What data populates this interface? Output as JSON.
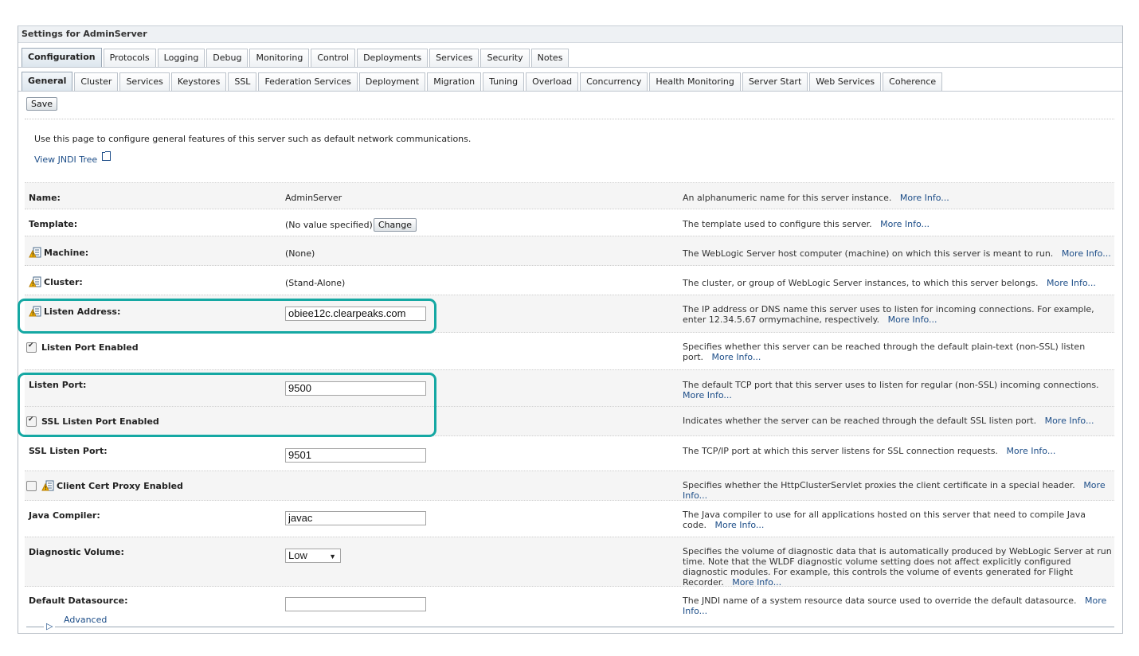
{
  "panel": {
    "title": "Settings for AdminServer"
  },
  "main_tabs": [
    {
      "label": "Configuration",
      "active": true
    },
    {
      "label": "Protocols"
    },
    {
      "label": "Logging"
    },
    {
      "label": "Debug"
    },
    {
      "label": "Monitoring"
    },
    {
      "label": "Control"
    },
    {
      "label": "Deployments"
    },
    {
      "label": "Services"
    },
    {
      "label": "Security"
    },
    {
      "label": "Notes"
    }
  ],
  "sub_tabs": [
    {
      "label": "General",
      "active": true
    },
    {
      "label": "Cluster"
    },
    {
      "label": "Services"
    },
    {
      "label": "Keystores"
    },
    {
      "label": "SSL"
    },
    {
      "label": "Federation Services"
    },
    {
      "label": "Deployment"
    },
    {
      "label": "Migration"
    },
    {
      "label": "Tuning"
    },
    {
      "label": "Overload"
    },
    {
      "label": "Concurrency"
    },
    {
      "label": "Health Monitoring"
    },
    {
      "label": "Server Start"
    },
    {
      "label": "Web Services"
    },
    {
      "label": "Coherence"
    }
  ],
  "toolbar": {
    "save_label": "Save"
  },
  "intro": {
    "text": "Use this page to configure general features of this server such as default network communications.",
    "jndi_link": "View JNDI Tree"
  },
  "more_info": "More Info...",
  "fields": {
    "name": {
      "label": "Name:",
      "value": "AdminServer",
      "desc": "An alphanumeric name for this server instance."
    },
    "template": {
      "label": "Template:",
      "value": "(No value specified)",
      "change": "Change",
      "desc": "The template used to configure this server."
    },
    "machine": {
      "label": "Machine:",
      "value": "(None)",
      "desc": "The WebLogic Server host computer (machine) on which this server is meant to run."
    },
    "cluster": {
      "label": "Cluster:",
      "value": "(Stand-Alone)",
      "desc": "The cluster, or group of WebLogic Server instances, to which this server belongs."
    },
    "listen_address": {
      "label": "Listen Address:",
      "value": "obiee12c.clearpeaks.com",
      "desc": "The IP address or DNS name this server uses to listen for incoming connections. For example, enter 12.34.5.67 ormymachine, respectively."
    },
    "listen_port_enabled": {
      "label": "Listen Port Enabled",
      "checked": true,
      "desc": "Specifies whether this server can be reached through the default plain-text (non-SSL) listen port."
    },
    "listen_port": {
      "label": "Listen Port:",
      "value": "9500",
      "desc": "The default TCP port that this server uses to listen for regular (non-SSL) incoming connections."
    },
    "ssl_listen_port_enabled": {
      "label": "SSL Listen Port Enabled",
      "checked": true,
      "desc": "Indicates whether the server can be reached through the default SSL listen port."
    },
    "ssl_listen_port": {
      "label": "SSL Listen Port:",
      "value": "9501",
      "desc": "The TCP/IP port at which this server listens for SSL connection requests."
    },
    "client_cert_proxy": {
      "label": "Client Cert Proxy Enabled",
      "checked": false,
      "desc": "Specifies whether the HttpClusterServlet proxies the client certificate in a special header."
    },
    "java_compiler": {
      "label": "Java Compiler:",
      "value": "javac",
      "desc": "The Java compiler to use for all applications hosted on this server that need to compile Java code."
    },
    "diagnostic_volume": {
      "label": "Diagnostic Volume:",
      "value": "Low",
      "desc": "Specifies the volume of diagnostic data that is automatically produced by WebLogic Server at run time. Note that the WLDF diagnostic volume setting does not affect explicitly configured diagnostic modules. For example, this controls the volume of events generated for Flight Recorder."
    },
    "default_datasource": {
      "label": "Default Datasource:",
      "value": "",
      "desc": "The JNDI name of a system resource data source used to override the default datasource."
    }
  },
  "advanced": "Advanced",
  "colors": {
    "highlight": "#15a8a3",
    "link": "#1c4d88",
    "row_shade": "#f5f5f5"
  }
}
